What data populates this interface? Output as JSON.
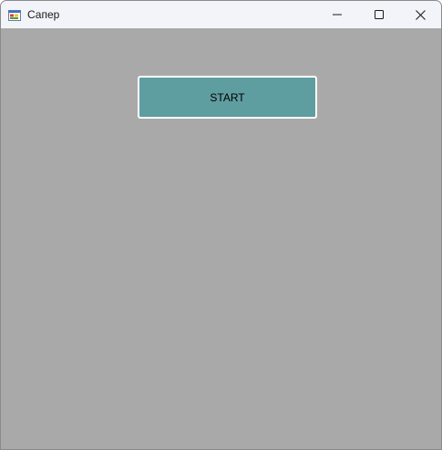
{
  "window": {
    "title": "Сапер",
    "icon": "winforms-app-icon",
    "controls": {
      "minimize_icon": "minimize-icon",
      "maximize_icon": "maximize-icon",
      "close_icon": "close-icon"
    }
  },
  "main": {
    "start_label": "START"
  },
  "colors": {
    "titlebar": "#f2f4f9",
    "client_background": "#a9a9a9",
    "button_background": "#5f9ea0",
    "button_border": "#ffffff"
  }
}
